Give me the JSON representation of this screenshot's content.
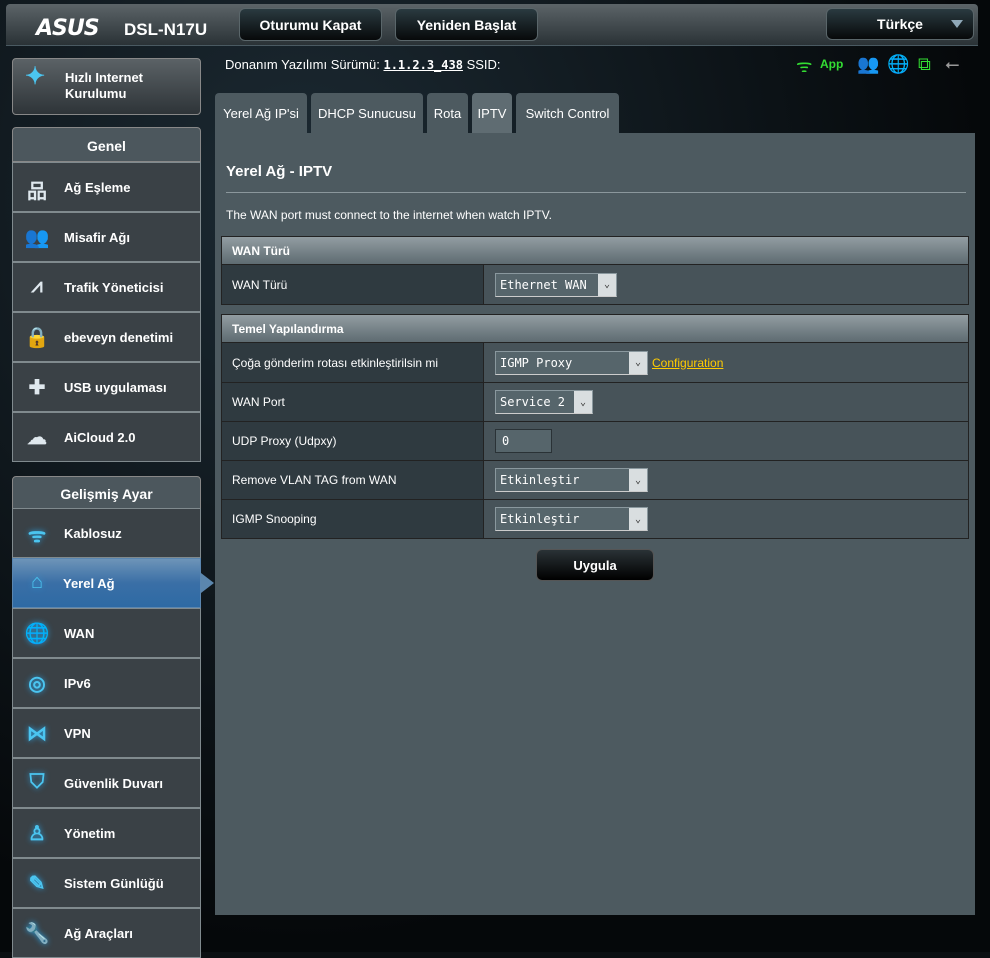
{
  "header": {
    "logo": "ASUS",
    "model": "DSL-N17U",
    "logout": "Oturumu Kapat",
    "reboot": "Yeniden Başlat",
    "language": "Türkçe"
  },
  "status": {
    "firmware_label": "Donanım Yazılımı Sürümü:",
    "firmware_version": "1.1.2.3_438",
    "ssid_label": "SSID:",
    "app_label": "App",
    "icons": [
      "wifi-icon",
      "clients-icon",
      "internet-globe-icon",
      "network-status-icon",
      "usb-icon"
    ],
    "accent_green": "#33dd33"
  },
  "sidebar": {
    "quick_setup": "Hızlı Internet Kurulumu",
    "general_header": "Genel",
    "general": [
      {
        "label": "Ağ Eşleme",
        "icon": "network-map-icon"
      },
      {
        "label": "Misafir Ağı",
        "icon": "guest-network-icon"
      },
      {
        "label": "Trafik Yöneticisi",
        "icon": "traffic-manager-icon"
      },
      {
        "label": "ebeveyn denetimi",
        "icon": "lock-icon"
      },
      {
        "label": "USB uygulaması",
        "icon": "puzzle-icon"
      },
      {
        "label": "AiCloud 2.0",
        "icon": "cloud-icon"
      }
    ],
    "advanced_header": "Gelişmiş Ayar",
    "advanced": [
      {
        "label": "Kablosuz",
        "icon": "wifi-icon"
      },
      {
        "label": "Yerel Ağ",
        "icon": "home-icon",
        "selected": true
      },
      {
        "label": "WAN",
        "icon": "globe-icon"
      },
      {
        "label": "IPv6",
        "icon": "ipv6-icon"
      },
      {
        "label": "VPN",
        "icon": "vpn-icon"
      },
      {
        "label": "Güvenlik Duvarı",
        "icon": "shield-icon"
      },
      {
        "label": "Yönetim",
        "icon": "admin-icon"
      },
      {
        "label": "Sistem Günlüğü",
        "icon": "log-icon"
      },
      {
        "label": "Ağ Araçları",
        "icon": "tools-icon"
      }
    ]
  },
  "tabs": [
    {
      "label": "Yerel Ağ IP'si"
    },
    {
      "label": "DHCP Sunucusu"
    },
    {
      "label": "Rota"
    },
    {
      "label": "IPTV",
      "active": true
    },
    {
      "label": "Switch Control"
    }
  ],
  "main": {
    "title": "Yerel Ağ - IPTV",
    "description": "The WAN port must connect to the internet when watch IPTV.",
    "wan_section": {
      "header": "WAN Türü",
      "label": "WAN Türü",
      "value": "Ethernet WAN"
    },
    "basic_section": {
      "header": "Temel Yapılandırma",
      "multicast_label": "Çoğa gönderim rotası etkinleştirilsin mi",
      "multicast_value": "IGMP Proxy",
      "config_link": "Configuration",
      "wan_port_label": "WAN Port",
      "wan_port_value": "Service 2",
      "udpxy_label": "UDP Proxy (Udpxy)",
      "udpxy_value": "0",
      "vlan_label": "Remove VLAN TAG from WAN",
      "vlan_value": "Etkinleştir",
      "snooping_label": "IGMP Snooping",
      "snooping_value": "Etkinleştir"
    },
    "apply": "Uygula"
  }
}
